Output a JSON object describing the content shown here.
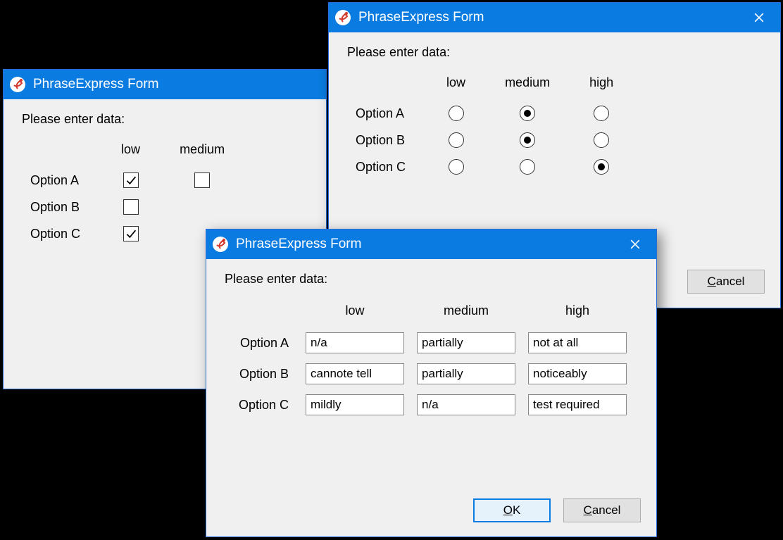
{
  "common": {
    "title": "PhraseExpress Form",
    "prompt": "Please enter data:",
    "columns": [
      "low",
      "medium",
      "high"
    ],
    "rows": [
      "Option A",
      "Option B",
      "Option C"
    ],
    "ok_label": "OK",
    "cancel_label": "Cancel"
  },
  "checkbox_window": {
    "visible_columns": [
      "low",
      "medium"
    ],
    "values": [
      [
        true,
        false
      ],
      [
        false,
        null
      ],
      [
        true,
        null
      ]
    ]
  },
  "radio_window": {
    "selected_index_per_row": [
      1,
      1,
      2
    ]
  },
  "text_window": {
    "values": [
      [
        "n/a",
        "partially",
        "not at all"
      ],
      [
        "cannote tell",
        "partially",
        "noticeably"
      ],
      [
        "mildly",
        "n/a",
        "test required"
      ]
    ]
  }
}
